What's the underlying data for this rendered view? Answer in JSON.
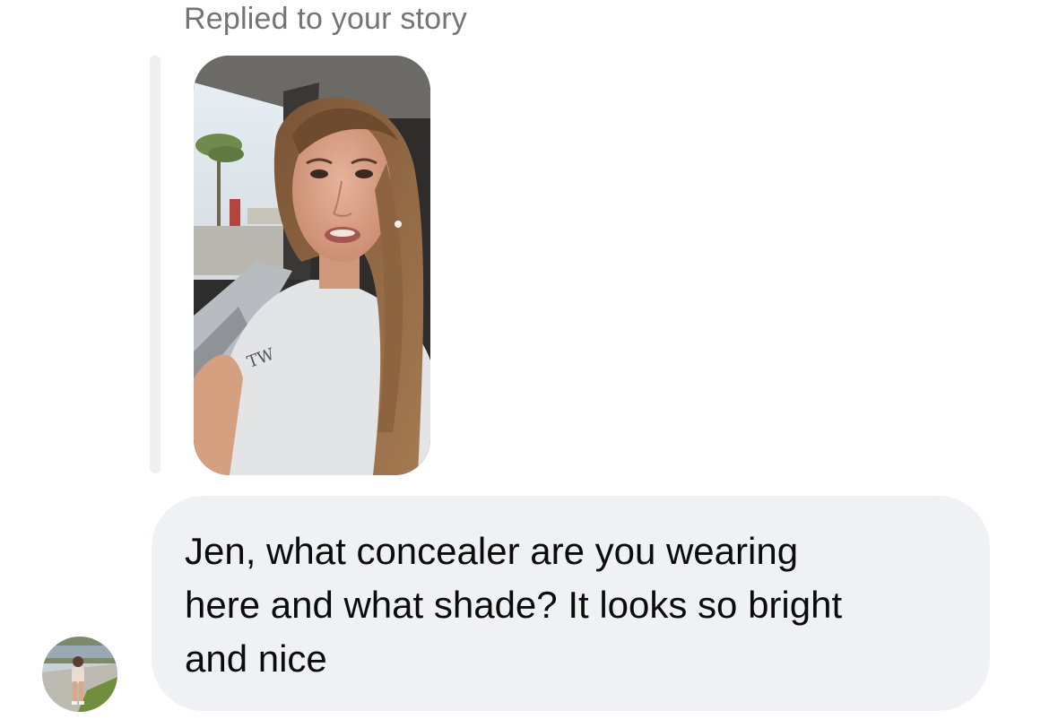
{
  "story_reply": {
    "label": "Replied to your story",
    "thumbnail": {
      "kind": "video-story-preview"
    }
  },
  "message": {
    "text": "Jen, what concealer are you wearing\nhere and what shade? It looks so bright\nand nice",
    "bubble_color": "#f0f1f4",
    "text_color": "#0b0b0c"
  },
  "sender": {
    "avatar_icon": "profile-photo"
  },
  "colors": {
    "label_gray": "#737378",
    "reply_bar": "#efeff1",
    "background": "#ffffff"
  }
}
